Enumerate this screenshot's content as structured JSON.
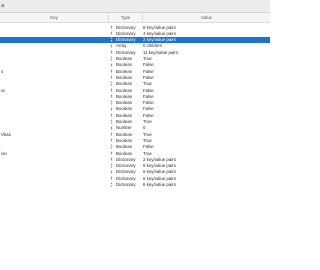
{
  "window": {
    "title": "st"
  },
  "columns": {
    "key": "Key",
    "type": "Type",
    "value": "Value"
  },
  "rows": [
    {
      "key": "",
      "type": "Dictionary",
      "value": "8 key/value pairs",
      "selected": false
    },
    {
      "key": "",
      "type": "Dictionary",
      "value": "4 key/value pairs",
      "selected": false
    },
    {
      "key": "",
      "type": "Dictionary",
      "value": "2 key/value pairs",
      "selected": true
    },
    {
      "key": "",
      "type": "Array",
      "value": "0 children",
      "selected": false
    },
    {
      "key": "",
      "type": "Dictionary",
      "value": "11 key/value pairs",
      "selected": false
    },
    {
      "key": "",
      "type": "Boolean",
      "value": "True",
      "selected": false
    },
    {
      "key": "",
      "type": "Boolean",
      "value": "False",
      "selected": false
    },
    {
      "key": "s",
      "type": "Boolean",
      "value": "False",
      "selected": false
    },
    {
      "key": "",
      "type": "Boolean",
      "value": "False",
      "selected": false
    },
    {
      "key": "",
      "type": "Boolean",
      "value": "True",
      "selected": false
    },
    {
      "key": "or",
      "type": "Boolean",
      "value": "False",
      "selected": false
    },
    {
      "key": "",
      "type": "Boolean",
      "value": "False",
      "selected": false
    },
    {
      "key": "",
      "type": "Boolean",
      "value": "False",
      "selected": false
    },
    {
      "key": "",
      "type": "Boolean",
      "value": "False",
      "selected": false
    },
    {
      "key": "",
      "type": "Boolean",
      "value": "False",
      "selected": false
    },
    {
      "key": "",
      "type": "Boolean",
      "value": "True",
      "selected": false
    },
    {
      "key": "",
      "type": "Number",
      "value": "0",
      "selected": false
    },
    {
      "key": "Vkas",
      "type": "Boolean",
      "value": "True",
      "selected": false
    },
    {
      "key": "",
      "type": "Boolean",
      "value": "True",
      "selected": false
    },
    {
      "key": "",
      "type": "Boolean",
      "value": "False",
      "selected": false
    },
    {
      "key": "ion",
      "type": "Boolean",
      "value": "True",
      "selected": false
    },
    {
      "key": "",
      "type": "Dictionary",
      "value": "2 key/value pairs",
      "selected": false
    },
    {
      "key": "",
      "type": "Dictionary",
      "value": "6 key/value pairs",
      "selected": false
    },
    {
      "key": "",
      "type": "Dictionary",
      "value": "6 key/value pairs",
      "selected": false
    },
    {
      "key": "",
      "type": "Dictionary",
      "value": "6 key/value pairs",
      "selected": false
    },
    {
      "key": "",
      "type": "Dictionary",
      "value": "6 key/value pairs",
      "selected": false
    }
  ]
}
